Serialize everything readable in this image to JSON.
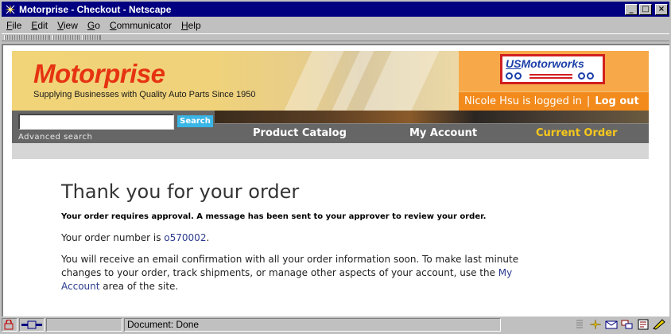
{
  "window": {
    "title": "Motorprise - Checkout - Netscape",
    "controls": {
      "minimize": "_",
      "maximize": "□",
      "close": "×"
    }
  },
  "menu": {
    "items": [
      {
        "key": "F",
        "rest": "ile"
      },
      {
        "key": "E",
        "rest": "dit"
      },
      {
        "key": "V",
        "rest": "iew"
      },
      {
        "key": "G",
        "rest": "o"
      },
      {
        "key": "C",
        "rest": "ommunicator"
      },
      {
        "key": "H",
        "rest": "elp"
      }
    ]
  },
  "header": {
    "brand_name": "Motorprise",
    "tagline": "Supplying Businesses with Quality Auto Parts Since 1950",
    "partner_logo": {
      "us": "US",
      "name": "Motorworks"
    },
    "login_text": "Nicole Hsu is logged in",
    "separator": "|",
    "logout_label": "Log out"
  },
  "search": {
    "value": "",
    "button_label": "Search",
    "advanced_label": "Advanced search"
  },
  "nav": {
    "items": [
      {
        "label": "Product Catalog",
        "current": false
      },
      {
        "label": "My Account",
        "current": false
      },
      {
        "label": "Current Order",
        "current": true
      }
    ]
  },
  "main": {
    "heading": "Thank you for your order",
    "approval_notice": "Your order requires approval. A message has been sent to your approver to review your order.",
    "order_number_prefix": "Your order number is ",
    "order_number": "o570002",
    "order_number_suffix": ".",
    "confirmation_part1": "You will receive an email confirmation with all your order information soon. To make last minute changes to your order, track shipments, or manage other aspects of your account, use the ",
    "confirmation_link": "My Account",
    "confirmation_part2": " area of the site."
  },
  "statusbar": {
    "status_text": "Document: Done"
  },
  "colors": {
    "title_bar": "#000080",
    "brand_red": "#e63312",
    "login_orange": "#f28a1c",
    "current_nav": "#f7c81c",
    "link": "#2b3a8f"
  }
}
